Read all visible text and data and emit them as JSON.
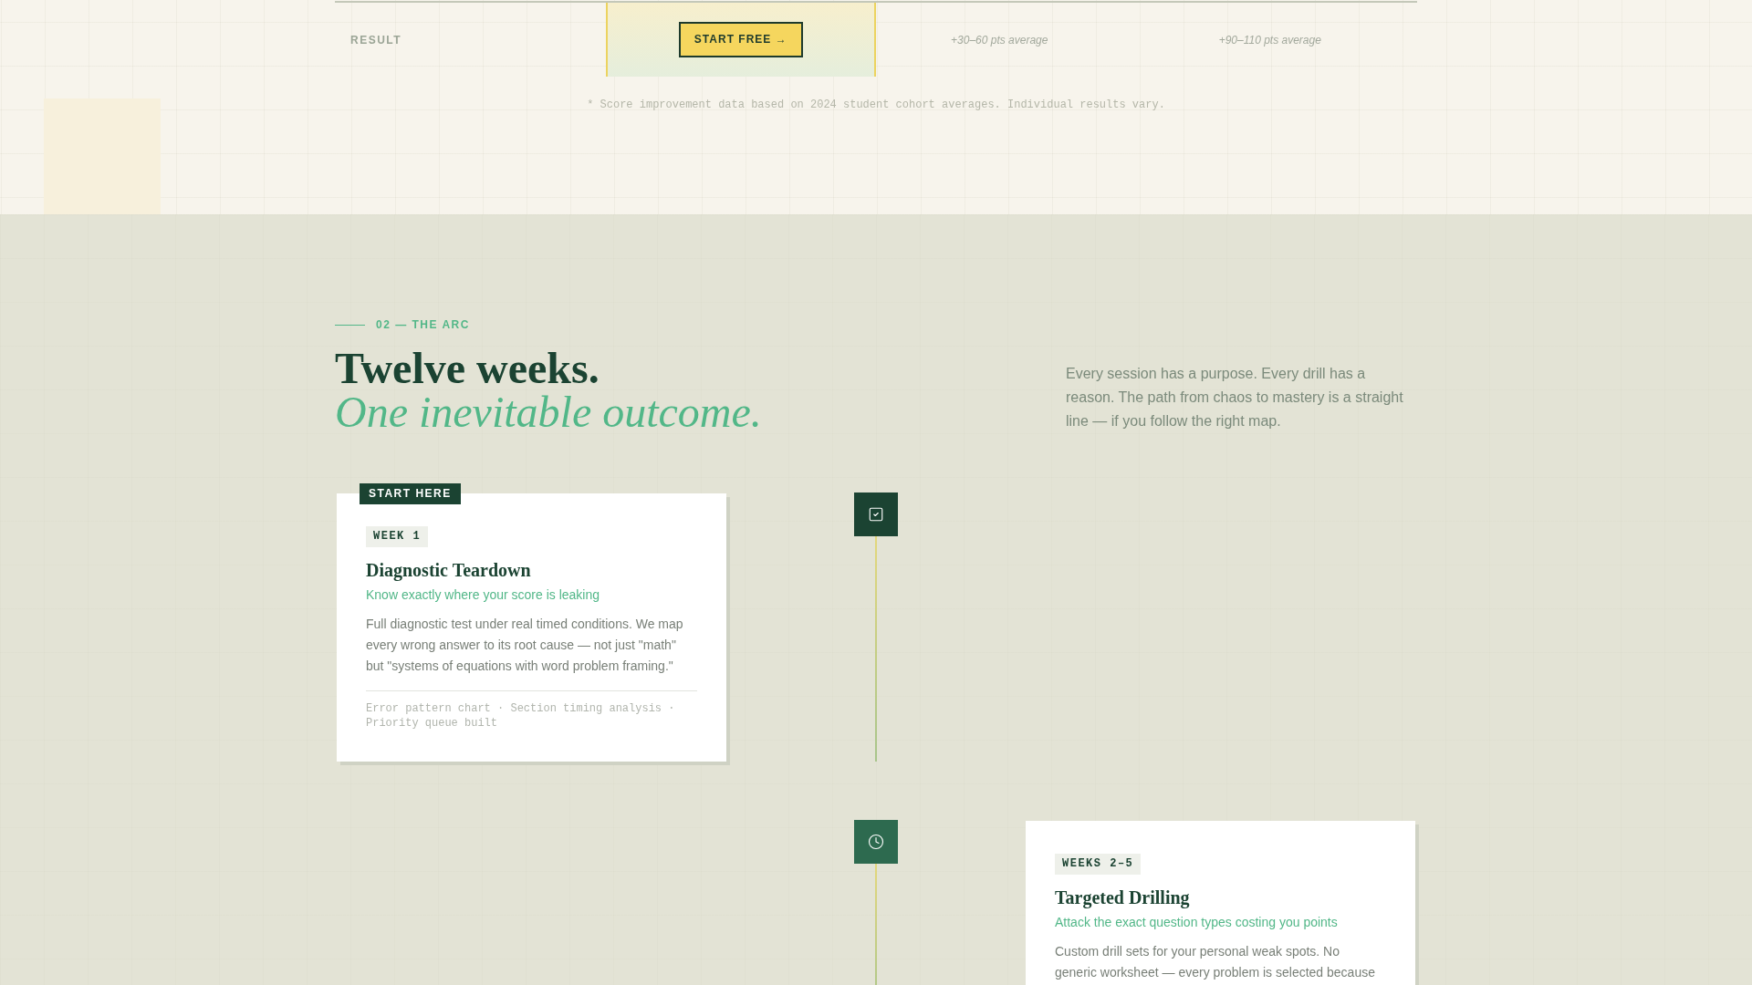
{
  "comparison": {
    "rows": [
      {
        "label": "RESULT",
        "cells": [
          {
            "kind": "button",
            "text": "START FREE →",
            "highlighted": true
          },
          {
            "kind": "text",
            "text": "+30–60 pts average",
            "highlighted": false
          },
          {
            "kind": "text",
            "text": "+90–110 pts average",
            "highlighted": false
          }
        ]
      }
    ],
    "footnote": "* Score improvement data based on 2024 student cohort averages. Individual results vary."
  },
  "arc": {
    "eyebrow": "02 — THE ARC",
    "title": "Twelve weeks.",
    "title_accent": "One inevitable outcome.",
    "intro": "Every session has a purpose. Every drill has a reason. The path from chaos to mastery is a straight line — if you follow the right map.",
    "steps": [
      {
        "completed": true,
        "badge": "START HERE",
        "week": "WEEK 1",
        "title": "Diagnostic Teardown",
        "subtitle": "Know exactly where your score is leaking",
        "body": "Full diagnostic test under real timed conditions. We map every wrong answer to its root cause — not just \"math\" but \"systems of equations with word problem framing.\"",
        "deliverables": "Error pattern chart · Section timing analysis · Priority queue built"
      },
      {
        "completed": false,
        "week": "WEEKS 2–5",
        "title": "Targeted Drilling",
        "subtitle": "Attack the exact question types costing you points",
        "body": "Custom drill sets for your personal weak spots. No generic worksheet — every problem is selected because"
      }
    ]
  }
}
